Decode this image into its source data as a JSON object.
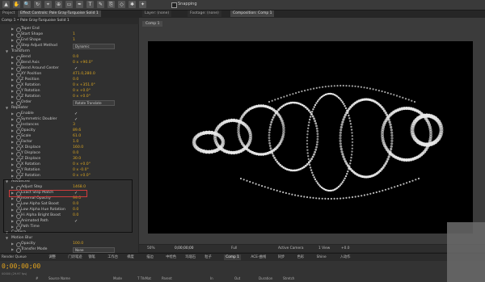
{
  "toolbar": {
    "snapping_label": "Snapping",
    "tool_icons": [
      "select-tool-icon",
      "hand-tool-icon",
      "zoom-tool-icon",
      "rotate-tool-icon",
      "camera-tool-icon",
      "pan-behind-icon",
      "shape-tool-icon",
      "pen-tool-icon",
      "text-tool-icon",
      "brush-tool-icon",
      "clone-stamp-icon",
      "eraser-icon",
      "roto-brush-icon",
      "puppet-pin-icon"
    ]
  },
  "tabs": {
    "project": "Project",
    "effect_controls": "Effect Controls: Pale Gray-Turquoise Solid 1",
    "layer": "Layer: (none)",
    "footage": "Footage: (none)",
    "composition": "Composition: Comp 1"
  },
  "effect_panel": {
    "layer_title": "Comp 1 • Pale Gray-Turquoise Solid 1",
    "rows": [
      {
        "label": "Taper End",
        "value": "",
        "kind": "text"
      },
      {
        "label": "Start Shape",
        "value": "1",
        "kind": "num"
      },
      {
        "label": "End Shape",
        "value": "1",
        "kind": "num"
      },
      {
        "label": "Step Adjust Method",
        "value": "Dynamic",
        "kind": "dropdown"
      },
      {
        "label": "Transform",
        "value": "",
        "kind": "group"
      },
      {
        "label": "Bend",
        "value": "0.0",
        "kind": "num"
      },
      {
        "label": "Bend Axis",
        "value": "0 x +90.0°",
        "kind": "num"
      },
      {
        "label": "Bend Around Center",
        "value": "✓",
        "kind": "check"
      },
      {
        "label": "XY Position",
        "value": "471.0,280.0",
        "kind": "num"
      },
      {
        "label": "Z Position",
        "value": "0.0",
        "kind": "num"
      },
      {
        "label": "X Rotation",
        "value": "0 x +351.0°",
        "kind": "num"
      },
      {
        "label": "Y Rotation",
        "value": "0 x +0.0°",
        "kind": "num"
      },
      {
        "label": "Z Rotation",
        "value": "0 x +0.0°",
        "kind": "num"
      },
      {
        "label": "Order",
        "value": "Rotate Translate",
        "kind": "dropdown"
      },
      {
        "label": "Repeater",
        "value": "",
        "kind": "group"
      },
      {
        "label": "Enable",
        "value": "✓",
        "kind": "check"
      },
      {
        "label": "Symmetric Doubler",
        "value": "✓",
        "kind": "check"
      },
      {
        "label": "Instances",
        "value": "3",
        "kind": "num"
      },
      {
        "label": "Opacity",
        "value": "89.6",
        "kind": "num"
      },
      {
        "label": "Scale",
        "value": "61.0",
        "kind": "num"
      },
      {
        "label": "Factor",
        "value": "1.0",
        "kind": "num"
      },
      {
        "label": "X Displace",
        "value": "160.0",
        "kind": "num"
      },
      {
        "label": "Y Displace",
        "value": "0.0",
        "kind": "num"
      },
      {
        "label": "Z Displace",
        "value": "30.0",
        "kind": "num"
      },
      {
        "label": "X Rotation",
        "value": "0 x +0.0°",
        "kind": "num"
      },
      {
        "label": "Y Rotation",
        "value": "0 x -0.0°",
        "kind": "num"
      },
      {
        "label": "Z Rotation",
        "value": "0 x +0.0°",
        "kind": "num"
      },
      {
        "label": "Advanced",
        "value": "",
        "kind": "group"
      },
      {
        "label": "Adjust Step",
        "value": "1468.0",
        "kind": "num"
      },
      {
        "label": "Exact Step Match",
        "value": "✓",
        "kind": "check"
      },
      {
        "label": "Internal Opacity",
        "value": "99.0",
        "kind": "num"
      },
      {
        "label": "Low Alpha Sat Boost",
        "value": "0.0",
        "kind": "num"
      },
      {
        "label": "Low Alpha Hue Rotation",
        "value": "0.0",
        "kind": "num"
      },
      {
        "label": "Hi Alpha Bright Boost",
        "value": "0.0",
        "kind": "num"
      },
      {
        "label": "Animated Path",
        "value": "✓",
        "kind": "check"
      },
      {
        "label": "Path Time",
        "value": "",
        "kind": "text"
      },
      {
        "label": "Camera",
        "value": "",
        "kind": "group"
      },
      {
        "label": "Motion Blur",
        "value": "",
        "kind": "group"
      },
      {
        "label": "Opacity",
        "value": "100.0",
        "kind": "num"
      },
      {
        "label": "Transfer Mode",
        "value": "None",
        "kind": "dropdown"
      }
    ]
  },
  "viewer": {
    "comp_tab": "Comp 1",
    "zoom": "50%",
    "timecode": "0;00;00;00",
    "resolution": "Full",
    "camera": "Active Camera",
    "views": "1 View",
    "offset": "+0.0"
  },
  "bottom_tabs": [
    "Render Queue",
    "调整",
    "门诗笔迹",
    "钢笔",
    "工作台",
    "梯度",
    "描边",
    "中绘色",
    "玛瑙石",
    "粒子",
    "Comp 1",
    "ACE-曲线",
    "同步",
    "色彩",
    "Shine",
    "入动作"
  ],
  "timeline": {
    "timecode": "0;00;00;00",
    "fps_note": "00000 (29.97 fps)",
    "headers": [
      "#",
      "Source Name",
      "Mode",
      "T TrkMat",
      "Parent",
      "In",
      "Out",
      "Duration",
      "Stretch"
    ]
  },
  "colors": {
    "accent_value": "#d9a521",
    "highlight_box": "#d23b3b",
    "canvas_bg": "#000000"
  }
}
